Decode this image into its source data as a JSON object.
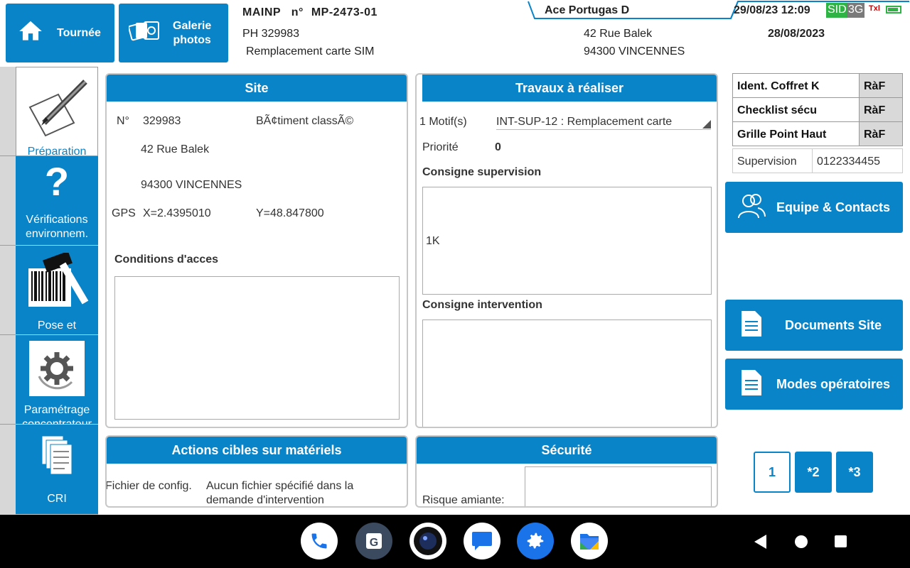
{
  "header": {
    "tournee_label": "Tournée",
    "galerie_label_1": "Galerie",
    "galerie_label_2": "photos",
    "mainp": "MAINP",
    "num_prefix": "n°",
    "mp_number": "MP-2473-01",
    "ph": "PH 329983",
    "subject": "Remplacement carte SIM",
    "address_street": "42 Rue Balek",
    "address_city": "94300 VINCENNES",
    "operator": "Ace Portugas D",
    "datetime": "29/08/23 12:09",
    "sid": "SID",
    "network": "3G",
    "date2": "28/08/2023"
  },
  "sidebar": {
    "items": [
      {
        "label": "Préparation"
      },
      {
        "label": "Vérifications environnem."
      },
      {
        "label": "Pose et"
      },
      {
        "label": "Paramétrage concentrateur"
      },
      {
        "label": "CRI"
      }
    ]
  },
  "site": {
    "title": "Site",
    "num_label": "N°",
    "num": "329983",
    "batiment": "BÃ¢timent classÃ©",
    "street": "42 Rue Balek",
    "city": "94300 VINCENNES",
    "gps_label": "GPS",
    "gps_x": "X=2.4395010",
    "gps_y": "Y=48.847800",
    "conditions_label": "Conditions d'acces"
  },
  "travaux": {
    "title": "Travaux à réaliser",
    "motif_label": "1 Motif(s)",
    "motif_value": "INT-SUP-12 : Remplacement carte",
    "priorite_label": "Priorité",
    "priorite_value": "0",
    "consigne_sup_label": "Consigne supervision",
    "consigne_sup_value": "1K",
    "consigne_int_label": "Consigne intervention"
  },
  "actions": {
    "title": "Actions cibles sur matériels",
    "fichier_label": "Fichier de config.",
    "fichier_value_1": "Aucun fichier spécifié dans la",
    "fichier_value_2": "demande d'intervention"
  },
  "securite": {
    "title": "Sécurité",
    "amiante_label": "Risque amiante:"
  },
  "checks": {
    "rows": [
      {
        "label": "Ident. Coffret K",
        "status": "RàF"
      },
      {
        "label": "Checklist sécu",
        "status": "RàF"
      },
      {
        "label": "Grille Point Haut",
        "status": "RàF"
      }
    ],
    "supervision_label": "Supervision",
    "supervision_value": "0122334455"
  },
  "buttons": {
    "equipe": "Equipe & Contacts",
    "documents": "Documents Site",
    "modes": "Modes opératoires"
  },
  "pages": [
    "1",
    "*2",
    "*3"
  ],
  "colors": {
    "accent": "#0a84c9",
    "panel_border": "#c7c7c7",
    "sid_green": "#2fb344"
  }
}
